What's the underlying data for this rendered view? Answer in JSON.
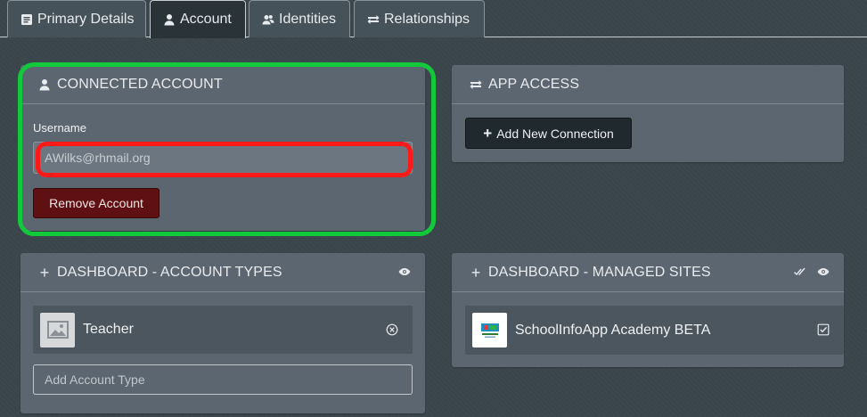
{
  "tabs": [
    {
      "label": "Primary Details",
      "icon": "document-icon"
    },
    {
      "label": "Account",
      "icon": "user-icon"
    },
    {
      "label": "Identities",
      "icon": "users-icon"
    },
    {
      "label": "Relationships",
      "icon": "swap-icon"
    }
  ],
  "active_tab": "Account",
  "connected_account": {
    "title": "CONNECTED ACCOUNT",
    "username_label": "Username",
    "username_value": "AWilks@rhmail.org",
    "remove_button": "Remove Account"
  },
  "app_access": {
    "title": "APP ACCESS",
    "add_button": "Add New Connection"
  },
  "account_types": {
    "title": "DASHBOARD - ACCOUNT TYPES",
    "items": [
      {
        "label": "Teacher"
      }
    ],
    "add_placeholder": "Add Account Type"
  },
  "managed_sites": {
    "title": "DASHBOARD - MANAGED SITES",
    "items": [
      {
        "label": "SchoolInfoApp Academy BETA"
      }
    ]
  },
  "colors": {
    "background": "#3b464c",
    "panel": "#5c6670",
    "danger_button": "#5e1012",
    "highlight_green": "#12c93c",
    "highlight_red": "#ff1a1a"
  }
}
